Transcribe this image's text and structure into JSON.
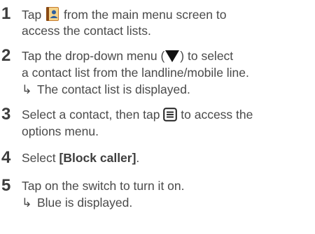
{
  "steps": [
    {
      "number": "1",
      "line1_before": "Tap",
      "line1_icon": "contacts-book-icon",
      "line1_after": "from the main menu screen to",
      "line2": "access the contact lists."
    },
    {
      "number": "2",
      "line1_before": "Tap the drop-down menu (",
      "line1_icon": "triangle-down-icon",
      "line1_after": ") to select",
      "line2": "a contact list from the landline/mobile line.",
      "result": "The contact list is displayed."
    },
    {
      "number": "3",
      "line1_before": "Select a contact, then tap",
      "line1_icon": "menu-icon",
      "line1_after": "to access the",
      "line2": "options menu."
    },
    {
      "number": "4",
      "line1_before": "Select",
      "line1_bold": "[Block caller]",
      "line1_after": "."
    },
    {
      "number": "5",
      "line1_before": "Tap on the switch to turn it on.",
      "result": "Blue is displayed."
    }
  ],
  "result_arrow": "↳"
}
